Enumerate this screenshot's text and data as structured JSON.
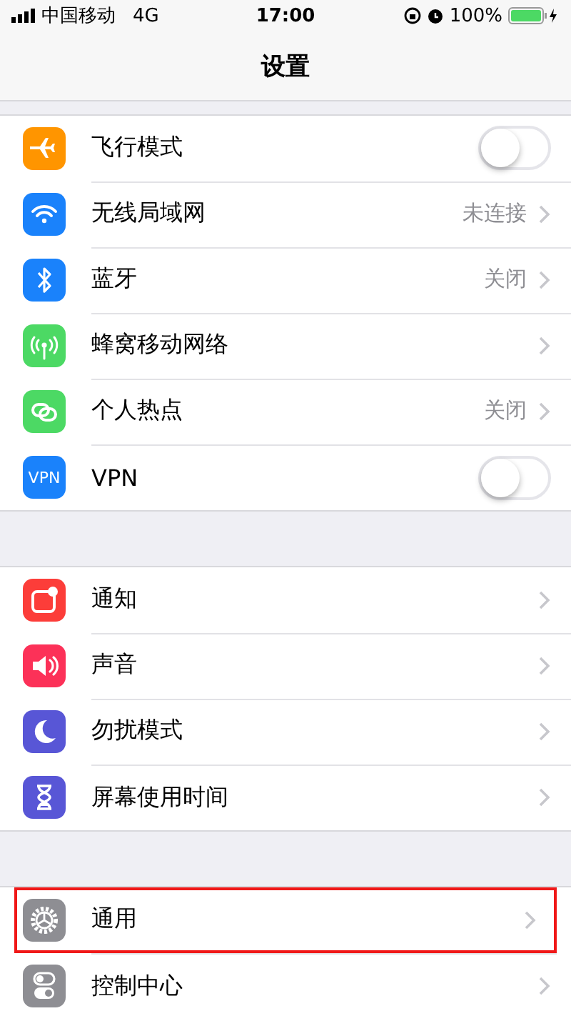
{
  "status_bar": {
    "carrier": "中国移动",
    "network": "4G",
    "time": "17:00",
    "battery": "100%"
  },
  "nav": {
    "title": "设置"
  },
  "groups": [
    {
      "items": [
        {
          "kind": "toggle",
          "label": "飞行模式",
          "color": "#ff9500",
          "on": false,
          "highlighted": false
        },
        {
          "kind": "link",
          "label": "无线局域网",
          "detail": "未连接",
          "color": "#1a82fb",
          "highlighted": false
        },
        {
          "kind": "link",
          "label": "蓝牙",
          "detail": "关闭",
          "color": "#1a82fb",
          "highlighted": false
        },
        {
          "kind": "link",
          "label": "蜂窝移动网络",
          "color": "#4cd964",
          "highlighted": false
        },
        {
          "kind": "link",
          "label": "个人热点",
          "detail": "关闭",
          "color": "#4cd964",
          "highlighted": false
        },
        {
          "kind": "toggle",
          "label": "VPN",
          "badge": "VPN",
          "color": "#1a82fb",
          "on": false,
          "highlighted": false
        }
      ]
    },
    {
      "items": [
        {
          "kind": "link",
          "label": "通知",
          "color": "#fc3d39",
          "highlighted": false
        },
        {
          "kind": "link",
          "label": "声音",
          "color": "#fc3158",
          "highlighted": false
        },
        {
          "kind": "link",
          "label": "勿扰模式",
          "color": "#5856d6",
          "highlighted": false
        },
        {
          "kind": "link",
          "label": "屏幕使用时间",
          "color": "#5856d6",
          "highlighted": false
        }
      ]
    },
    {
      "items": [
        {
          "kind": "link",
          "label": "通用",
          "color": "#8e8e93",
          "highlighted": true
        },
        {
          "kind": "link",
          "label": "控制中心",
          "color": "#8e8e93",
          "highlighted": false
        }
      ]
    }
  ]
}
